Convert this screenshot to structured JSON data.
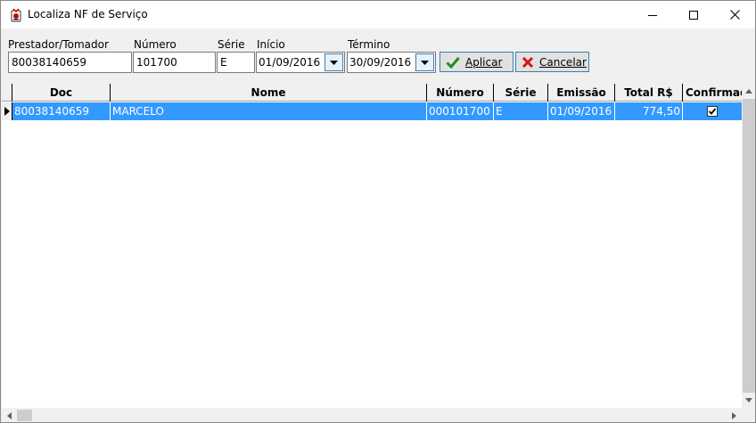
{
  "window": {
    "title": "Localiza NF de Serviço"
  },
  "filters": {
    "prestador_label": "Prestador/Tomador",
    "prestador_value": "80038140659",
    "numero_label": "Número",
    "numero_value": "101700",
    "serie_label": "Série",
    "serie_value": "E",
    "inicio_label": "Início",
    "inicio_value": "01/09/2016",
    "termino_label": "Término",
    "termino_value": "30/09/2016"
  },
  "buttons": {
    "aplicar_label": "Aplicar",
    "cancelar_label": "Cancelar"
  },
  "grid": {
    "columns": [
      "Doc",
      "Nome",
      "Número",
      "Série",
      "Emissão",
      "Total R$",
      "Confirmada"
    ],
    "rows": [
      {
        "doc": "80038140659",
        "nome": "MARCELO",
        "numero": "000101700",
        "serie": "E",
        "emissao": "01/09/2016",
        "total": "774,50",
        "confirmada": true
      }
    ]
  },
  "colors": {
    "selection": "#3399ff",
    "check_green": "#1e8c1e",
    "cancel_red": "#d0151b"
  },
  "icons": {
    "app": "app-icon",
    "aplicar": "checkmark-icon",
    "cancelar": "x-icon",
    "dropdown": "chevron-down-icon"
  }
}
